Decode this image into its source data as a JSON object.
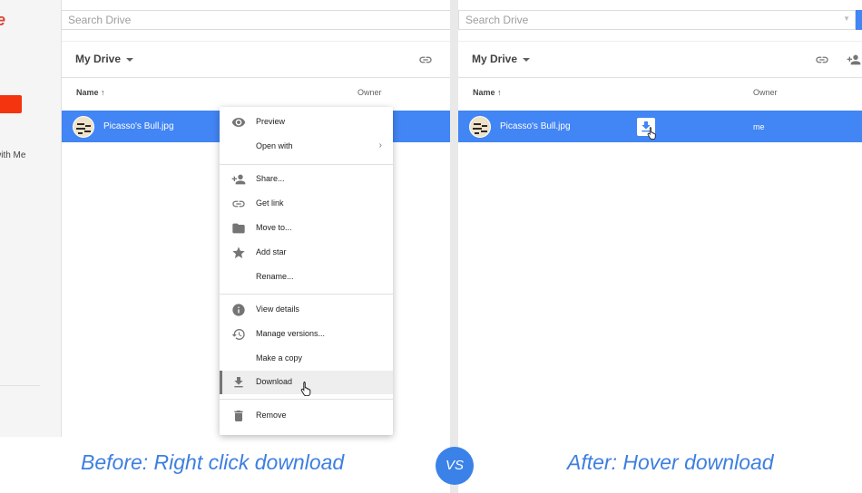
{
  "before": {
    "search": {
      "placeholder": "Search Drive"
    },
    "sidebar": {
      "items": [
        {
          "label": "e"
        },
        {
          "label": "with Me"
        }
      ]
    },
    "toolbar": {
      "title": "My Drive"
    },
    "columns": {
      "name": "Name ↑",
      "owner": "Owner"
    },
    "file": {
      "name": "Picasso's Bull.jpg"
    },
    "context_menu": {
      "items": [
        {
          "label": "Preview",
          "icon": "eye-icon"
        },
        {
          "label": "Open with",
          "icon": "",
          "submenu": "›"
        },
        {
          "label": "Share...",
          "icon": "add-person-icon"
        },
        {
          "label": "Get link",
          "icon": "link-icon"
        },
        {
          "label": "Move to...",
          "icon": "folder-icon"
        },
        {
          "label": "Add star",
          "icon": "star-icon"
        },
        {
          "label": "Rename...",
          "icon": ""
        },
        {
          "label": "View details",
          "icon": "info-icon"
        },
        {
          "label": "Manage versions...",
          "icon": "history-icon"
        },
        {
          "label": "Make a copy",
          "icon": ""
        },
        {
          "label": "Download",
          "icon": "download-icon",
          "active": true
        },
        {
          "label": "Remove",
          "icon": "trash-icon"
        }
      ]
    }
  },
  "after": {
    "search": {
      "placeholder": "Search Drive"
    },
    "toolbar": {
      "title": "My Drive"
    },
    "columns": {
      "name": "Name ↑",
      "owner": "Owner"
    },
    "file": {
      "name": "Picasso's Bull.jpg",
      "owner": "me"
    }
  },
  "captions": {
    "before": "Before: Right click download",
    "vs": "VS",
    "after": "After: Hover download"
  },
  "colors": {
    "accent": "#4285f4",
    "caption": "#3d7fe0",
    "brand_red": "#db4437"
  }
}
